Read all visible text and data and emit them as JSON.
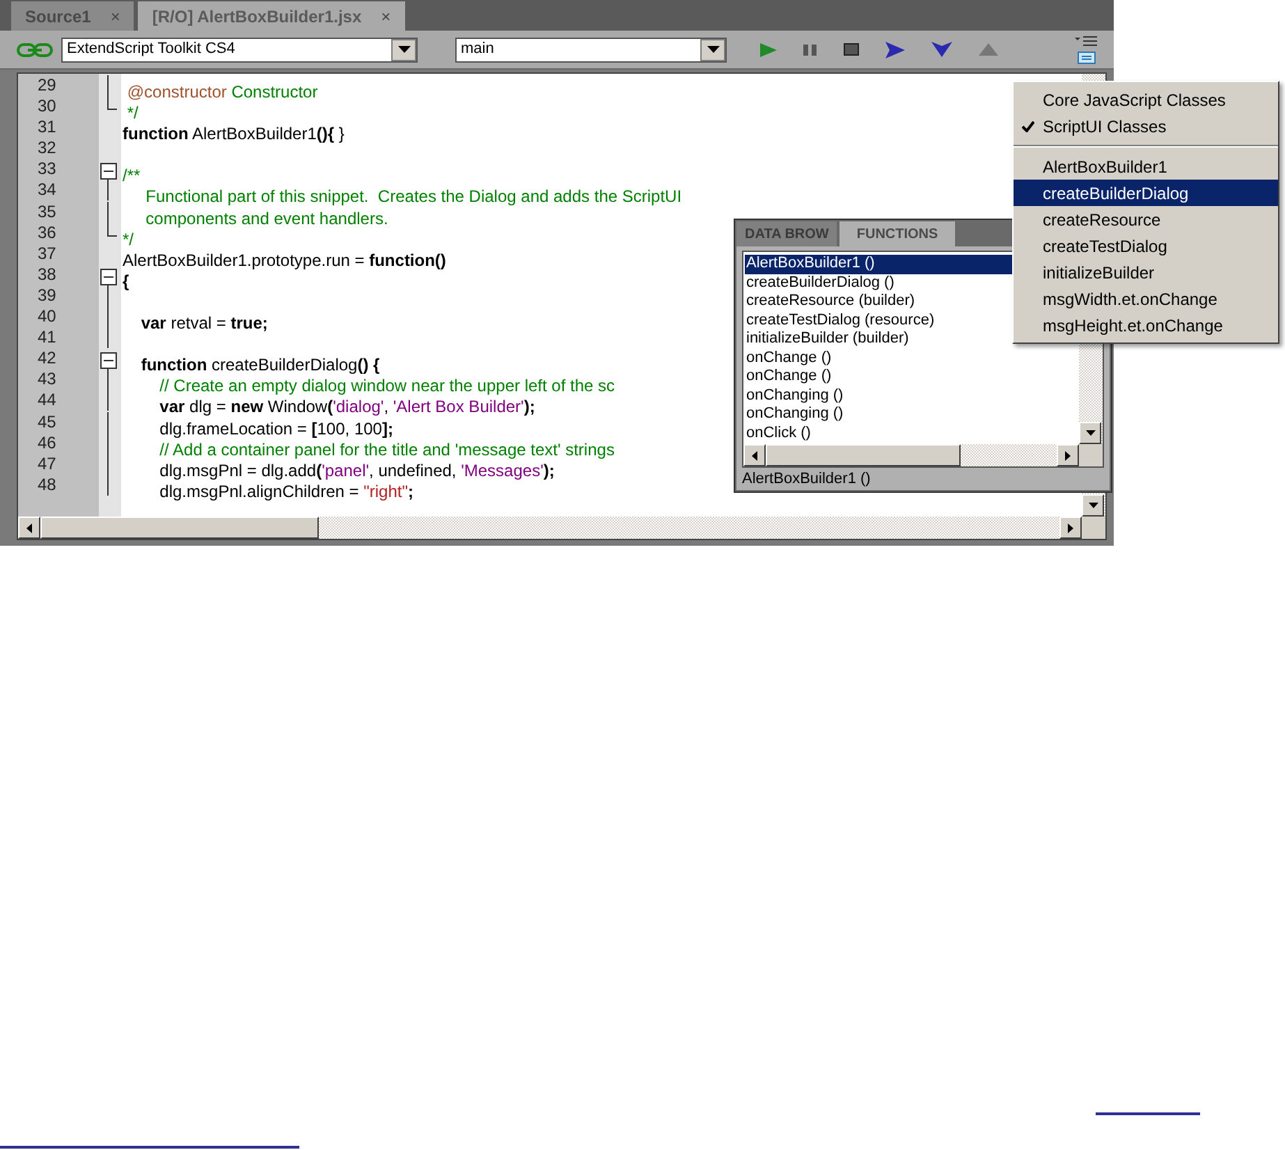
{
  "tabs": [
    {
      "label": "Source1",
      "close": "×",
      "selected": false
    },
    {
      "label": "[R/O] AlertBoxBuilder1.jsx",
      "close": "×",
      "selected": true
    }
  ],
  "toolbar": {
    "target": "ExtendScript Toolkit CS4",
    "engine": "main"
  },
  "code": [
    {
      "number": "29",
      "kind": "body",
      "segments": [
        {
          "kind": "doc",
          "text": " @constructor"
        },
        {
          "kind": "comment",
          "text": " Constructor"
        }
      ]
    },
    {
      "number": "30",
      "kind": "end",
      "segments": [
        {
          "kind": "comment",
          "text": " */"
        }
      ]
    },
    {
      "number": "31",
      "kind": "plain",
      "segments": [
        {
          "kind": "kw",
          "text": "function"
        },
        {
          "kind": "plain",
          "text": " AlertBoxBuilder1"
        },
        {
          "kind": "kw",
          "text": "(){"
        },
        {
          "kind": "plain",
          "text": " }"
        }
      ]
    },
    {
      "number": "32",
      "kind": "plain"
    },
    {
      "number": "33",
      "kind": "start",
      "segments": [
        {
          "kind": "comment",
          "text": "/**"
        }
      ]
    },
    {
      "number": "34",
      "kind": "body",
      "segments": [
        {
          "kind": "comment",
          "text": "     Functional part of this snippet.  Creates the Dialog and adds the ScriptUI"
        }
      ]
    },
    {
      "number": "35",
      "kind": "body",
      "segments": [
        {
          "kind": "comment",
          "text": "     components and event handlers."
        }
      ]
    },
    {
      "number": "36",
      "kind": "end",
      "segments": [
        {
          "kind": "comment",
          "text": "*/"
        }
      ]
    },
    {
      "number": "37",
      "kind": "plain",
      "segments": [
        {
          "kind": "plain",
          "text": "AlertBoxBuilder1.prototype.run = "
        },
        {
          "kind": "kw",
          "text": "function()"
        }
      ]
    },
    {
      "number": "38",
      "kind": "start",
      "segments": [
        {
          "kind": "kw",
          "text": "{"
        }
      ]
    },
    {
      "number": "39",
      "kind": "body"
    },
    {
      "number": "40",
      "kind": "body",
      "segments": [
        {
          "kind": "kw",
          "text": "    var"
        },
        {
          "kind": "plain",
          "text": " retval = "
        },
        {
          "kind": "kw",
          "text": "true;"
        }
      ]
    },
    {
      "number": "41",
      "kind": "body"
    },
    {
      "number": "42",
      "kind": "start",
      "segments": [
        {
          "kind": "kw",
          "text": "    function"
        },
        {
          "kind": "plain",
          "text": " createBuilderDialog"
        },
        {
          "kind": "kw",
          "text": "() {"
        }
      ]
    },
    {
      "number": "43",
      "kind": "body",
      "segments": [
        {
          "kind": "comment",
          "text": "        // Create an empty dialog window near the upper left of the sc"
        }
      ]
    },
    {
      "number": "44",
      "kind": "body",
      "segments": [
        {
          "kind": "kw",
          "text": "        var"
        },
        {
          "kind": "plain",
          "text": " dlg = "
        },
        {
          "kind": "kw",
          "text": "new"
        },
        {
          "kind": "plain",
          "text": " Window"
        },
        {
          "kind": "kw",
          "text": "("
        },
        {
          "kind": "string",
          "text": "'dialog'"
        },
        {
          "kind": "plain",
          "text": ", "
        },
        {
          "kind": "string",
          "text": "'Alert Box Builder'"
        },
        {
          "kind": "kw",
          "text": ");"
        }
      ]
    },
    {
      "number": "45",
      "kind": "body",
      "segments": [
        {
          "kind": "plain",
          "text": "        dlg.frameLocation = "
        },
        {
          "kind": "kw",
          "text": "["
        },
        {
          "kind": "plain",
          "text": "100, 100"
        },
        {
          "kind": "kw",
          "text": "];"
        }
      ]
    },
    {
      "number": "46",
      "kind": "body",
      "segments": [
        {
          "kind": "comment",
          "text": "        // Add a container panel for the title and 'message text' strings"
        }
      ]
    },
    {
      "number": "47",
      "kind": "body",
      "segments": [
        {
          "kind": "plain",
          "text": "        dlg.msgPnl = dlg.add"
        },
        {
          "kind": "kw",
          "text": "("
        },
        {
          "kind": "string",
          "text": "'panel'"
        },
        {
          "kind": "plain",
          "text": ", undefined, "
        },
        {
          "kind": "string",
          "text": "'Messages'"
        },
        {
          "kind": "kw",
          "text": ");"
        }
      ]
    },
    {
      "number": "48",
      "kind": "body",
      "segments": [
        {
          "kind": "plain",
          "text": "        dlg.msgPnl.alignChildren = "
        },
        {
          "kind": "literal",
          "text": "\"right\""
        },
        {
          "kind": "kw",
          "text": ";"
        }
      ]
    }
  ],
  "functions_panel": {
    "tabs": [
      {
        "label": "DATA BROW",
        "selected": false
      },
      {
        "label": "FUNCTIONS",
        "selected": true
      }
    ],
    "items": [
      {
        "label": "AlertBoxBuilder1 ()",
        "selected": true
      },
      {
        "label": "createBuilderDialog ()",
        "selected": false
      },
      {
        "label": "createResource (builder)",
        "selected": false
      },
      {
        "label": "createTestDialog (resource)",
        "selected": false
      },
      {
        "label": "initializeBuilder (builder)",
        "selected": false
      },
      {
        "label": "onChange ()",
        "selected": false
      },
      {
        "label": "onChange ()",
        "selected": false
      },
      {
        "label": "onChanging ()",
        "selected": false
      },
      {
        "label": "onChanging ()",
        "selected": false
      },
      {
        "label": "onClick ()",
        "selected": false
      }
    ],
    "status": "AlertBoxBuilder1 ()"
  },
  "menu": {
    "class_options": [
      {
        "label": "Core JavaScript Classes",
        "checked": false
      },
      {
        "label": "ScriptUI Classes",
        "checked": true
      }
    ],
    "functions": [
      {
        "label": "AlertBoxBuilder1",
        "selected": false
      },
      {
        "label": "createBuilderDialog",
        "selected": true
      },
      {
        "label": "createResource",
        "selected": false
      },
      {
        "label": "createTestDialog",
        "selected": false
      },
      {
        "label": "initializeBuilder",
        "selected": false
      },
      {
        "label": "msgWidth.et.onChange",
        "selected": false
      },
      {
        "label": "msgHeight.et.onChange",
        "selected": false
      }
    ]
  }
}
